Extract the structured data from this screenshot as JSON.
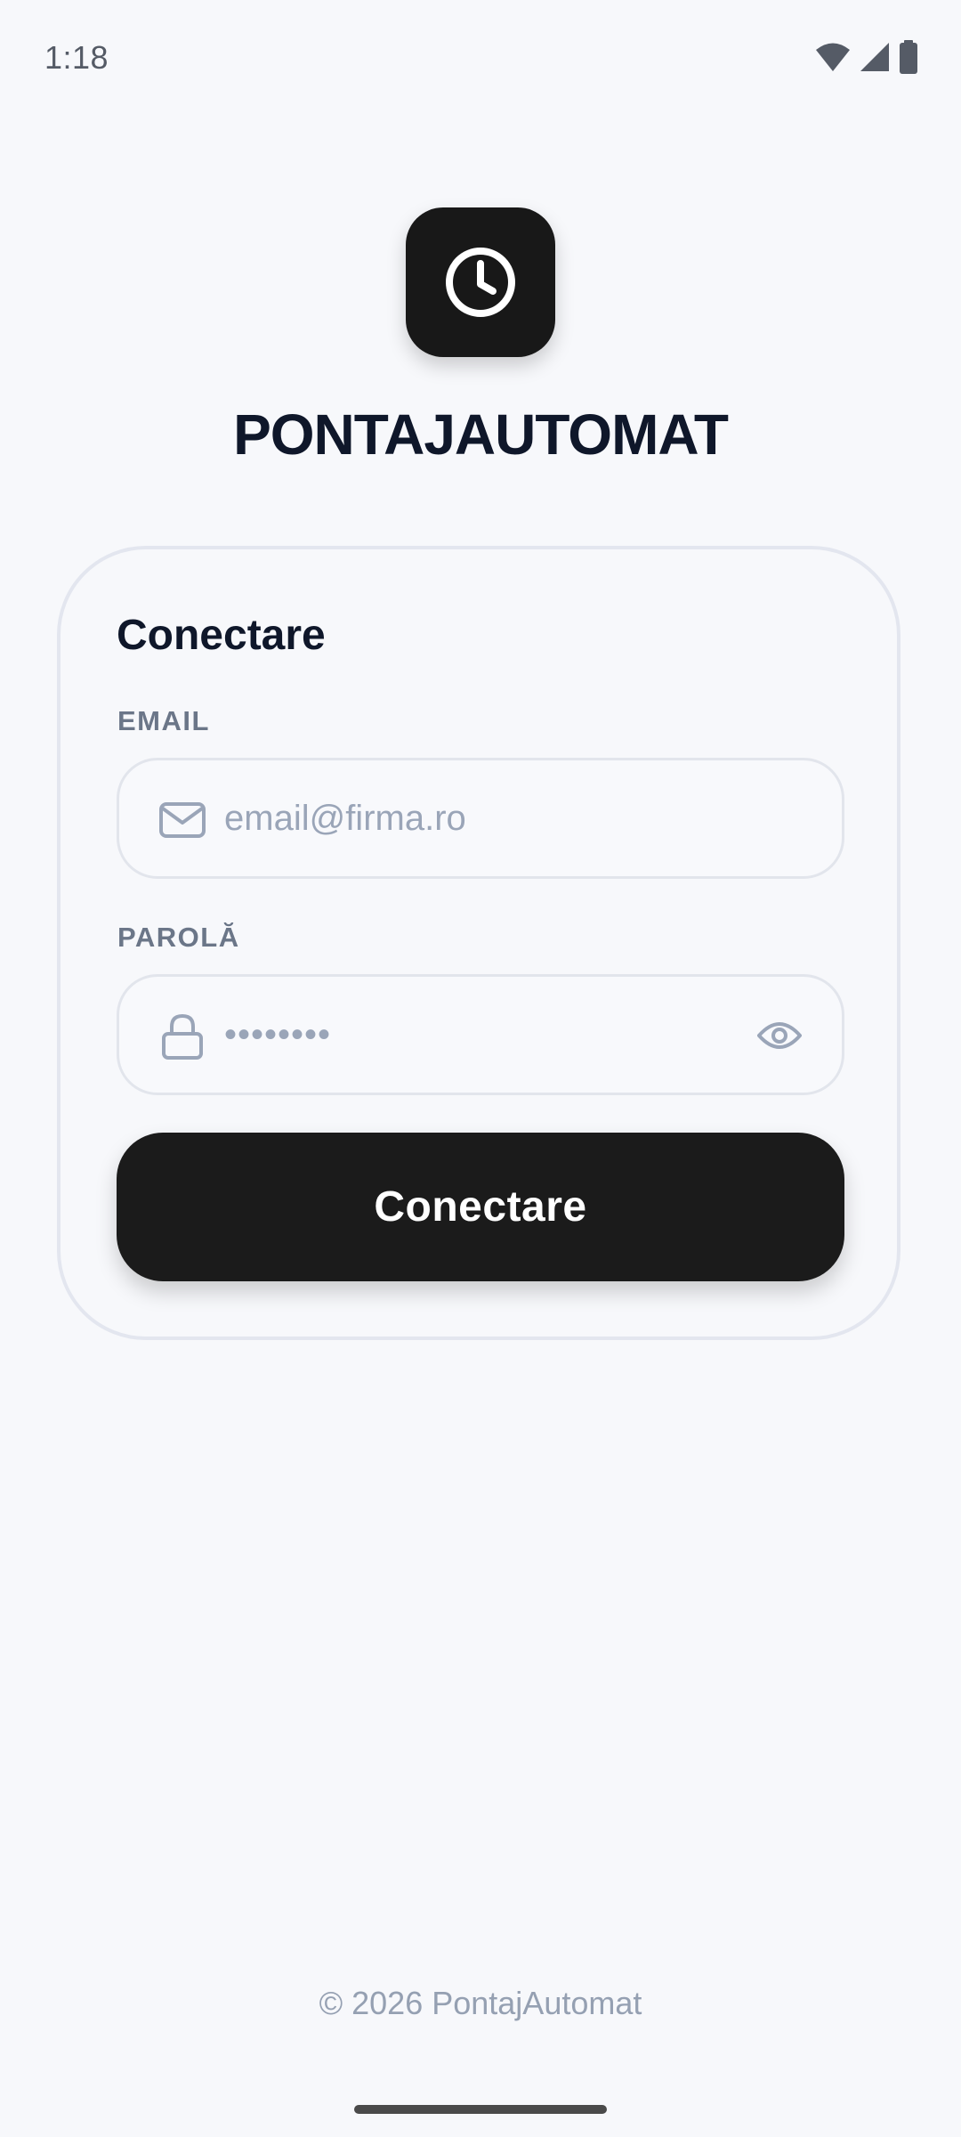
{
  "status_bar": {
    "time": "1:18",
    "icons": [
      "wifi-icon",
      "cellular-signal-icon",
      "battery-icon"
    ]
  },
  "app": {
    "logo_icon": "clock-icon",
    "title": "PONTAJAUTOMAT"
  },
  "login_form": {
    "title": "Conectare",
    "email": {
      "label": "EMAIL",
      "placeholder": "email@firma.ro",
      "value": "",
      "icon": "mail-icon"
    },
    "password": {
      "label": "PAROLĂ",
      "masked_value": "••••••••",
      "icon": "lock-icon",
      "toggle_icon": "eye-icon"
    },
    "submit_label": "Conectare"
  },
  "footer": {
    "copyright": "© 2026 PontajAutomat"
  },
  "colors": {
    "background": "#f7f8fb",
    "primary_button": "#1b1b1b",
    "title_text": "#0f172a",
    "label_text": "#6b7688",
    "placeholder_text": "#9aa5b8"
  }
}
